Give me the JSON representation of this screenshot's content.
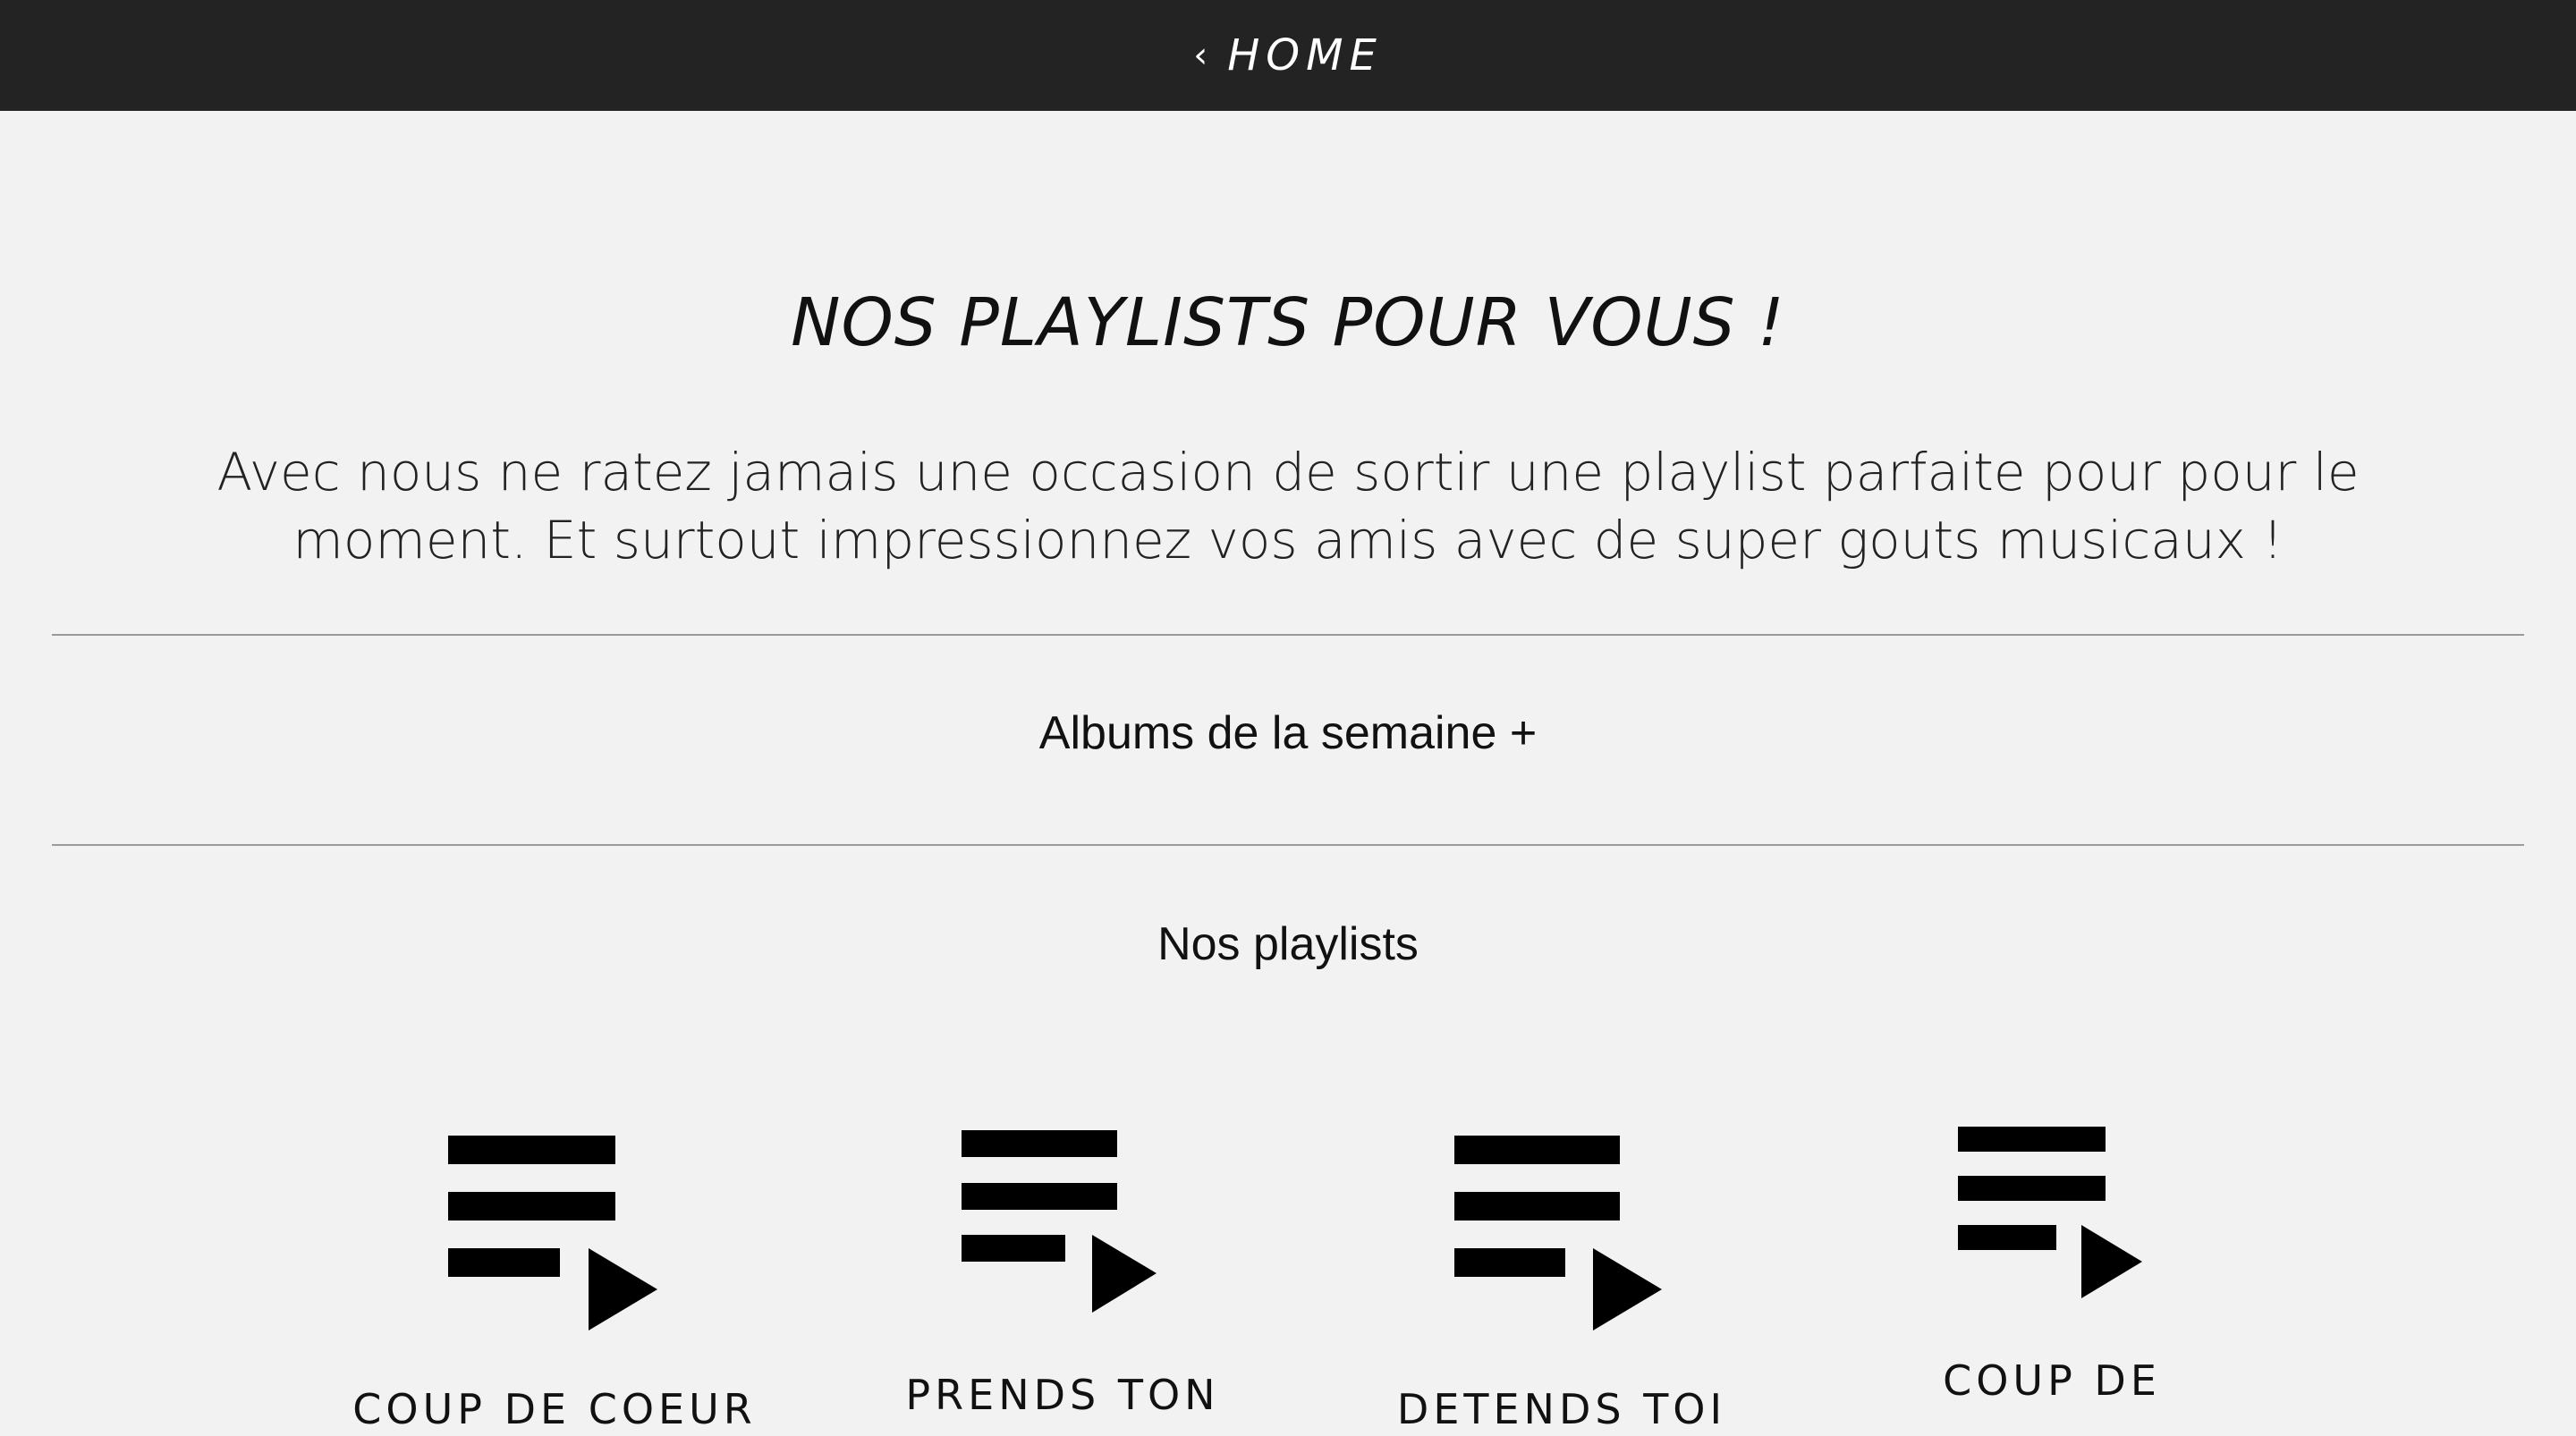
{
  "topbar": {
    "back_chevron": "‹",
    "home_label": "HOME"
  },
  "page": {
    "title": "NOS PLAYLISTS POUR VOUS !",
    "intro": "Avec nous ne ratez jamais une occasion de sortir une playlist parfaite pour pour le moment. Et surtout impressionnez vos amis avec de super gouts musicaux !"
  },
  "albums_toggle": {
    "label": "Albums de la semaine +"
  },
  "playlists_section": {
    "heading": "Nos playlists",
    "items": [
      {
        "label": "COUP DE COEUR",
        "icon": "playlist-play-icon"
      },
      {
        "label": "PRENDS TON",
        "icon": "playlist-play-icon"
      },
      {
        "label": "DETENDS TOI",
        "icon": "playlist-play-icon"
      },
      {
        "label": "COUP DE",
        "icon": "playlist-play-icon"
      }
    ]
  },
  "colors": {
    "topbar_bg": "#232323",
    "page_bg": "#f2f2f2",
    "text": "#111111",
    "divider": "#9a9a9a"
  }
}
